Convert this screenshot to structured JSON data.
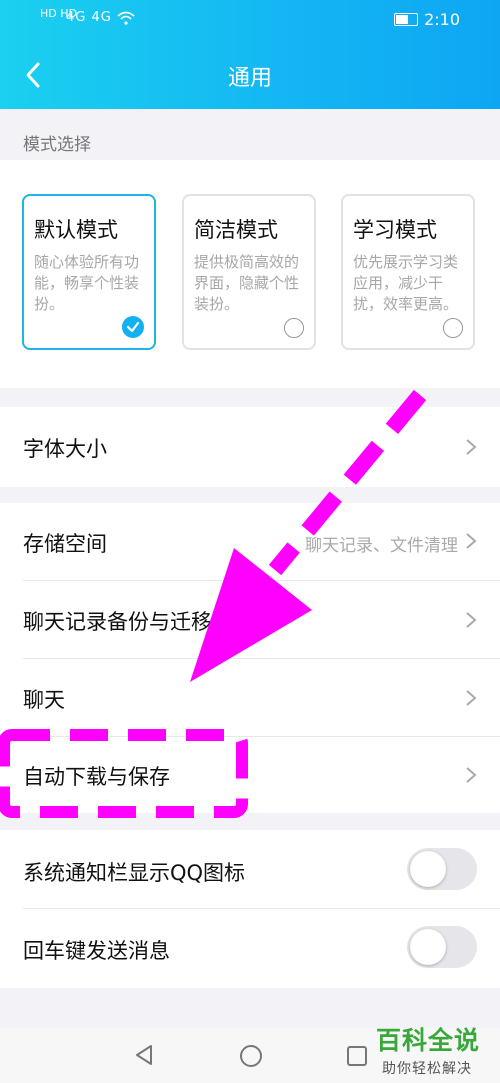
{
  "status_bar": {
    "left_icons": "HD HD",
    "network": "4G 4G",
    "time": "2:10",
    "icons": [
      "hd-icon",
      "signal-icon",
      "wifi-icon",
      "battery-icon"
    ]
  },
  "header": {
    "title": "通用",
    "back_icon": "chevron-left-icon"
  },
  "mode_section": {
    "label": "模式选择",
    "modes": [
      {
        "title": "默认模式",
        "desc": "随心体验所有功能，畅享个性装扮。",
        "selected": true
      },
      {
        "title": "简洁模式",
        "desc": "提供极简高效的界面，隐藏个性装扮。",
        "selected": false
      },
      {
        "title": "学习模式",
        "desc": "优先展示学习类应用，减少干扰，效率更高。",
        "selected": false
      }
    ]
  },
  "settings": {
    "font_size": {
      "label": "字体大小"
    },
    "storage": {
      "label": "存储空间",
      "value": "聊天记录、文件清理"
    },
    "chat_backup": {
      "label": "聊天记录备份与迁移"
    },
    "chat": {
      "label": "聊天"
    },
    "auto_download": {
      "label": "自动下载与保存"
    },
    "notify_qq_icon": {
      "label": "系统通知栏显示QQ图标",
      "enabled": false
    },
    "enter_send": {
      "label": "回车键发送消息",
      "enabled": false
    }
  },
  "bottom_nav": {
    "icons": [
      "back-triangle-icon",
      "home-circle-icon",
      "recents-square-icon"
    ]
  },
  "watermark": {
    "title": "百科全说",
    "subtitle": "助你轻松解决"
  },
  "colors": {
    "accent": "#11b1f2",
    "annotation": "#ff00ff",
    "watermark_green": "#39a83a"
  }
}
